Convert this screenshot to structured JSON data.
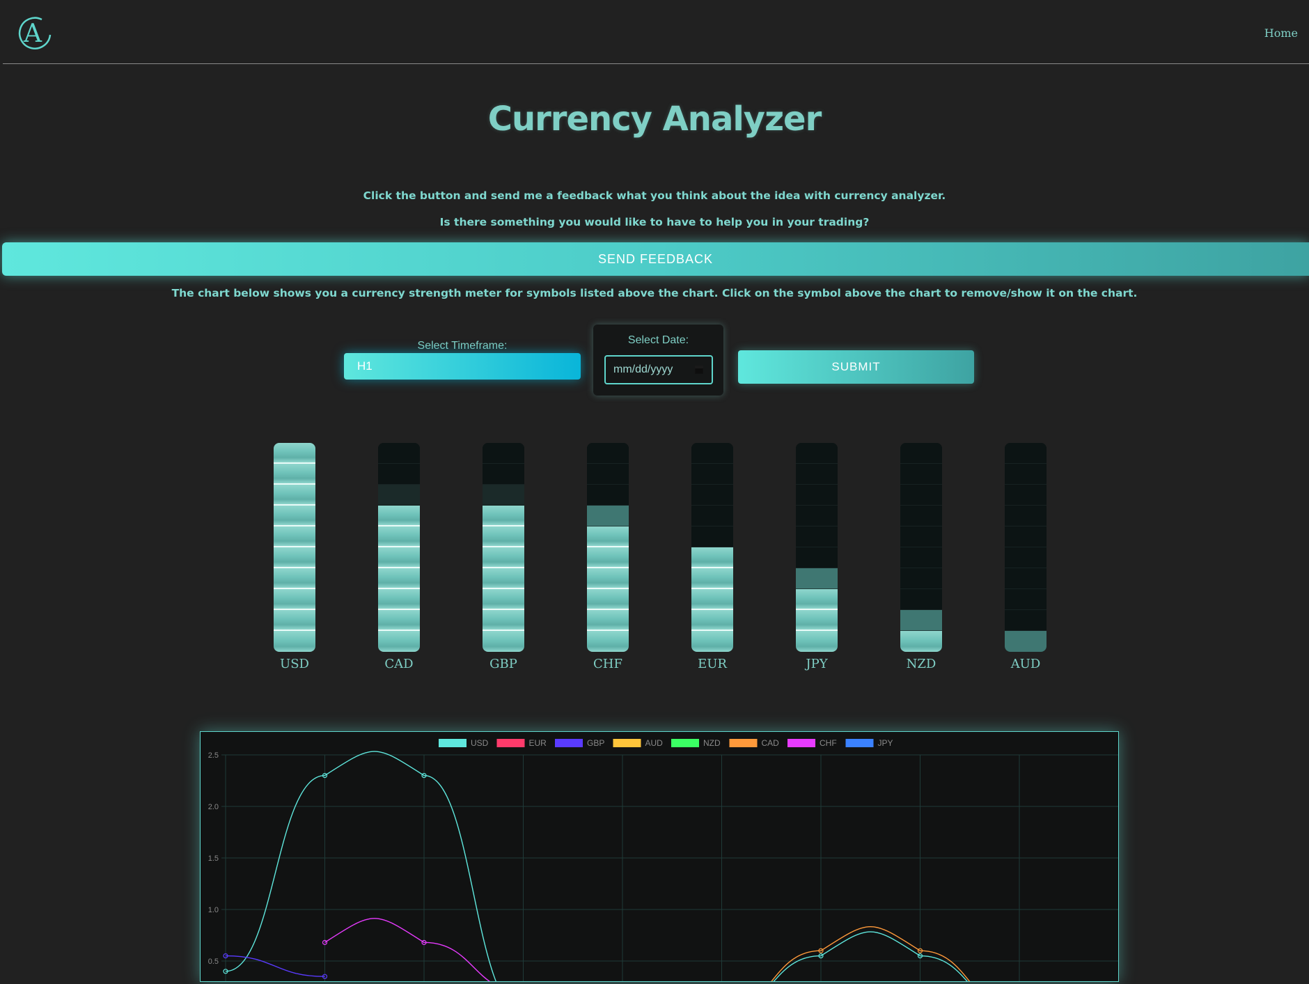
{
  "header": {
    "logo_letter": "A",
    "nav_home": "Home"
  },
  "page_title": "Currency Analyzer",
  "intro": {
    "line1": "Click the button and send me a feedback what you think about the idea with currency analyzer.",
    "line2": "Is there something you would like to have to help you in your trading?"
  },
  "feedback_button": "SEND FEEDBACK",
  "chart_description": "The chart below shows you a currency strength meter for symbols listed above the chart. Click on the symbol above the chart to remove/show it on the chart.",
  "controls": {
    "timeframe_label": "Select Timeframe:",
    "timeframe_value": "H1",
    "date_label": "Select Date:",
    "date_placeholder": "mm/dd/yyyy",
    "submit_label": "SUBMIT"
  },
  "strength_meters": [
    {
      "symbol": "USD",
      "level": 10
    },
    {
      "symbol": "CAD",
      "level": 7,
      "faint": 1
    },
    {
      "symbol": "GBP",
      "level": 7,
      "faint": 1
    },
    {
      "symbol": "CHF",
      "level": 6,
      "partial": 1
    },
    {
      "symbol": "EUR",
      "level": 5
    },
    {
      "symbol": "JPY",
      "level": 3,
      "partial": 1
    },
    {
      "symbol": "NZD",
      "level": 1,
      "partial": 1
    },
    {
      "symbol": "AUD",
      "level": 0,
      "partial": 1
    }
  ],
  "colors": {
    "accent": "#5fe7dd",
    "background": "#212121",
    "text": "#7fcfc5"
  },
  "chart_data": {
    "type": "line",
    "legend_position": "top",
    "grid": true,
    "ylim": [
      0,
      2.5
    ],
    "y_ticks": [
      "2.5",
      "2.0",
      "1.5",
      "1.0",
      "0.5"
    ],
    "x": [
      0,
      1,
      2,
      3,
      4,
      5,
      6,
      7,
      8
    ],
    "series": [
      {
        "name": "USD",
        "color": "#5fe7dd",
        "values": [
          0.4,
          2.3,
          2.3,
          0.0,
          null,
          null,
          null,
          null,
          null
        ]
      },
      {
        "name": "EUR",
        "color": "#ff3b6b",
        "values": []
      },
      {
        "name": "GBP",
        "color": "#5a3bff",
        "values": [
          0.55,
          0.35,
          null,
          null,
          null,
          null,
          null,
          null,
          null
        ]
      },
      {
        "name": "AUD",
        "color": "#ffc53b",
        "values": []
      },
      {
        "name": "NZD",
        "color": "#3bff64",
        "values": []
      },
      {
        "name": "CAD",
        "color": "#ff9a3b",
        "values": [
          null,
          null,
          null,
          null,
          null,
          0.0,
          0.6,
          0.6,
          0.0
        ]
      },
      {
        "name": "CHF",
        "color": "#e83bff",
        "values": [
          null,
          0.68,
          0.68,
          0.2,
          null,
          null,
          null,
          null,
          null
        ]
      },
      {
        "name": "JPY",
        "color": "#3b82ff",
        "values": []
      }
    ],
    "extra_line": {
      "color": "#5fe7dd",
      "values": [
        null,
        null,
        null,
        null,
        null,
        0.0,
        0.55,
        0.55,
        0.0
      ]
    }
  }
}
